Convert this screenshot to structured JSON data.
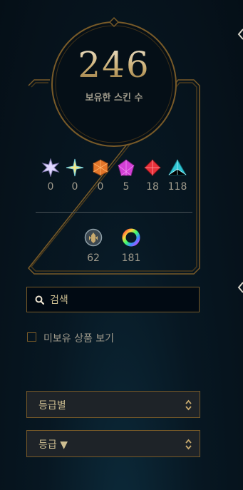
{
  "summary": {
    "skin_count": "246",
    "skin_count_label": "보유한 스킨 수"
  },
  "gems": [
    {
      "icon": "ultimate-gem-icon",
      "color": "#e0d8ff",
      "value": "0"
    },
    {
      "icon": "mythic-gem-icon",
      "color": "#f4e98a",
      "value": "0"
    },
    {
      "icon": "legendary-gem-icon",
      "color": "#e3762a",
      "value": "0"
    },
    {
      "icon": "epic-gem-icon",
      "color": "#d23fd6",
      "value": "5"
    },
    {
      "icon": "rare-gem-icon",
      "color": "#e8313b",
      "value": "18"
    },
    {
      "icon": "standard-gem-icon",
      "color": "#2fc4d3",
      "value": "118"
    }
  ],
  "badges": [
    {
      "icon": "legacy-icon",
      "value": "62"
    },
    {
      "icon": "chroma-icon",
      "value": "181"
    }
  ],
  "search": {
    "placeholder": "검색",
    "value": ""
  },
  "filters": {
    "owned_toggle_label": "미보유 상품 보기",
    "group_select_label": "등급별",
    "sort_select_label": "등급 ▼"
  }
}
